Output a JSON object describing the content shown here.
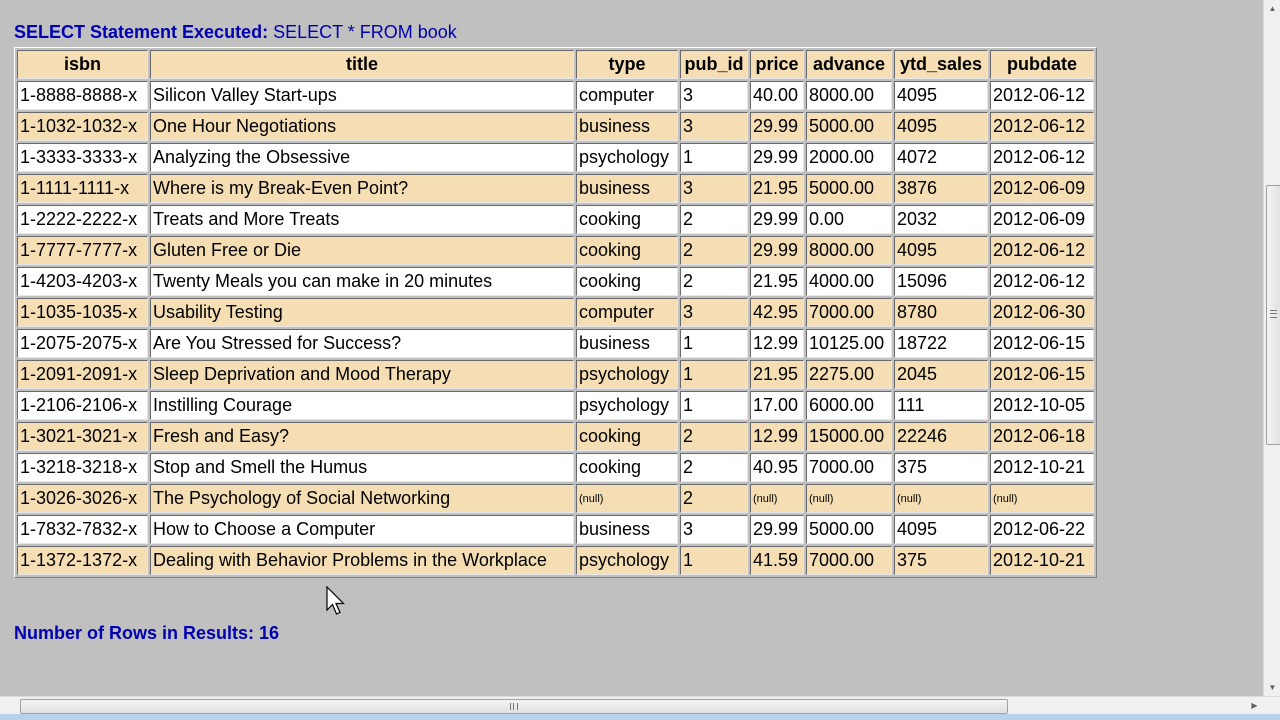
{
  "statement": {
    "label": "SELECT Statement Executed:",
    "sql": " SELECT * FROM book"
  },
  "table": {
    "columns": [
      "isbn",
      "title",
      "type",
      "pub_id",
      "price",
      "advance",
      "ytd_sales",
      "pubdate"
    ],
    "rows": [
      [
        "1-8888-8888-x",
        "Silicon Valley Start-ups",
        "computer",
        "3",
        "40.00",
        "8000.00",
        "4095",
        "2012-06-12"
      ],
      [
        "1-1032-1032-x",
        "One Hour Negotiations",
        "business",
        "3",
        "29.99",
        "5000.00",
        "4095",
        "2012-06-12"
      ],
      [
        "1-3333-3333-x",
        "Analyzing the Obsessive",
        "psychology",
        "1",
        "29.99",
        "2000.00",
        "4072",
        "2012-06-12"
      ],
      [
        "1-1111-1111-x",
        "Where is my Break-Even Point?",
        "business",
        "3",
        "21.95",
        "5000.00",
        "3876",
        "2012-06-09"
      ],
      [
        "1-2222-2222-x",
        "Treats and More Treats",
        "cooking",
        "2",
        "29.99",
        "0.00",
        "2032",
        "2012-06-09"
      ],
      [
        "1-7777-7777-x",
        "Gluten Free or Die",
        "cooking",
        "2",
        "29.99",
        "8000.00",
        "4095",
        "2012-06-12"
      ],
      [
        "1-4203-4203-x",
        "Twenty Meals you can make in 20 minutes",
        "cooking",
        "2",
        "21.95",
        "4000.00",
        "15096",
        "2012-06-12"
      ],
      [
        "1-1035-1035-x",
        "Usability Testing",
        "computer",
        "3",
        "42.95",
        "7000.00",
        "8780",
        "2012-06-30"
      ],
      [
        "1-2075-2075-x",
        "Are You Stressed for Success?",
        "business",
        "1",
        "12.99",
        "10125.00",
        "18722",
        "2012-06-15"
      ],
      [
        "1-2091-2091-x",
        "Sleep Deprivation and Mood Therapy",
        "psychology",
        "1",
        "21.95",
        "2275.00",
        "2045",
        "2012-06-15"
      ],
      [
        "1-2106-2106-x",
        "Instilling Courage",
        "psychology",
        "1",
        "17.00",
        "6000.00",
        "111",
        "2012-10-05"
      ],
      [
        "1-3021-3021-x",
        "Fresh and Easy?",
        "cooking",
        "2",
        "12.99",
        "15000.00",
        "22246",
        "2012-06-18"
      ],
      [
        "1-3218-3218-x",
        "Stop and Smell the Humus",
        "cooking",
        "2",
        "40.95",
        "7000.00",
        "375",
        "2012-10-21"
      ],
      [
        "1-3026-3026-x",
        "The Psychology of Social Networking",
        "(null)",
        "2",
        "(null)",
        "(null)",
        "(null)",
        "(null)"
      ],
      [
        "1-7832-7832-x",
        "How to Choose a Computer",
        "business",
        "3",
        "29.99",
        "5000.00",
        "4095",
        "2012-06-22"
      ],
      [
        "1-1372-1372-x",
        "Dealing with Behavior Problems in the Workplace",
        "psychology",
        "1",
        "41.59",
        "7000.00",
        "375",
        "2012-10-21"
      ]
    ],
    "null_text": "(null)"
  },
  "footer": {
    "row_count_text": "Number of Rows in Results: 16"
  },
  "colors": {
    "heading_blue": "#0000b0",
    "row_alt": "#f5deb3",
    "row_plain": "#ffffff",
    "null_text": "#8b0000",
    "page_bg": "#c0c0c0"
  }
}
